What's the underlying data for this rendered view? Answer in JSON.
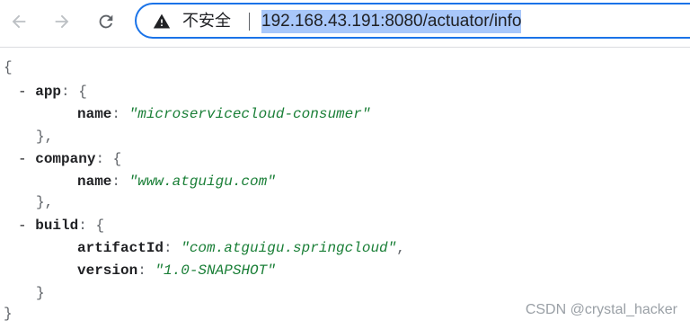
{
  "toolbar": {
    "back_icon": "back-arrow-icon",
    "forward_icon": "forward-arrow-icon",
    "reload_icon": "reload-icon",
    "security_label": "不安全",
    "url": "192.168.43.191:8080/actuator/info"
  },
  "json_view": {
    "open_brace": "{",
    "close_brace": "}",
    "toggle": "-",
    "app": {
      "key": "app",
      "name_key": "name",
      "name_value": "\"microservicecloud-consumer\""
    },
    "company": {
      "key": "company",
      "name_key": "name",
      "name_value": "\"www.atguigu.com\""
    },
    "build": {
      "key": "build",
      "artifact_key": "artifactId",
      "artifact_value": "\"com.atguigu.springcloud\"",
      "version_key": "version",
      "version_value": "\"1.0-SNAPSHOT\""
    },
    "obj_open": "{",
    "obj_close": "}",
    "obj_close_comma": "},"
  },
  "watermark": "CSDN @crystal_hacker",
  "colors": {
    "accent": "#1a73e8",
    "url_highlight": "#a8c7fa",
    "string_value": "#1a7f37"
  }
}
